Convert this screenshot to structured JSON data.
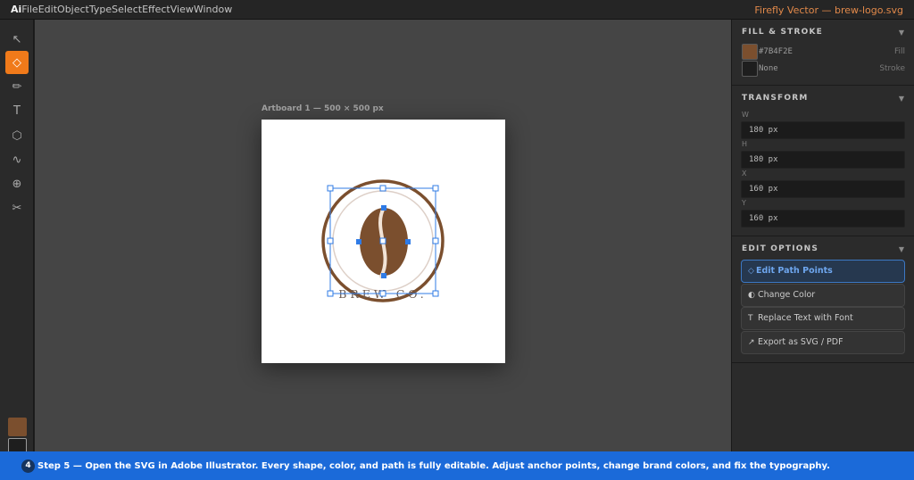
{
  "app": {
    "logo": "Ai",
    "document_title": "Firefly Vector — brew-logo.svg"
  },
  "menu": [
    "File",
    "Edit",
    "Object",
    "Type",
    "Select",
    "Effect",
    "View",
    "Window"
  ],
  "tools": [
    {
      "name": "selection-tool",
      "glyph": "↖"
    },
    {
      "name": "direct-selection-tool",
      "glyph": "◇",
      "active": true
    },
    {
      "name": "pen-tool",
      "glyph": "✏"
    },
    {
      "name": "type-tool",
      "glyph": "T"
    },
    {
      "name": "shape-tool",
      "glyph": "⬡"
    },
    {
      "name": "curvature-tool",
      "glyph": "∿"
    },
    {
      "name": "zoom-tool",
      "glyph": "⊕"
    },
    {
      "name": "scissors-tool",
      "glyph": "✂"
    }
  ],
  "swatches": {
    "fill": "#7B4F2E",
    "stroke": "None"
  },
  "canvas": {
    "artboard_label": "Artboard 1 — 500 × 500 px",
    "logo_text": "BREW CO."
  },
  "panel": {
    "fill_stroke": {
      "heading": "FILL & STROKE",
      "fill_value": "#7B4F2E",
      "fill_label": "Fill",
      "stroke_value": "None",
      "stroke_label": "Stroke"
    },
    "transform": {
      "heading": "TRANSFORM",
      "w_label": "W",
      "w_value": "180 px",
      "h_label": "H",
      "h_value": "180 px",
      "x_label": "X",
      "x_value": "160 px",
      "y_label": "Y",
      "y_value": "160 px"
    },
    "edit_options": {
      "heading": "EDIT OPTIONS",
      "items": [
        {
          "label": "Edit Path Points",
          "icon": "◇"
        },
        {
          "label": "Change Color",
          "icon": "◐"
        },
        {
          "label": "Replace Text with Font",
          "icon": "T"
        },
        {
          "label": "Export as SVG / PDF",
          "icon": "↗"
        }
      ]
    }
  },
  "footer": {
    "step_number": "4",
    "text": "Step 5 — Open the SVG in Adobe Illustrator. Every shape, color, and path is fully editable. Adjust anchor points, change brand colors, and fix the typography."
  },
  "colors": {
    "accent": "#F07A1A",
    "brand_brown": "#7B4F2E",
    "selection_blue": "#2F7BE6",
    "footer_blue": "#1B6AD9"
  }
}
